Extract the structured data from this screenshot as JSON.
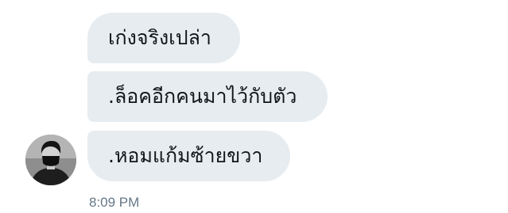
{
  "conversation": {
    "messages": [
      {
        "text": "เก่งจริงเปล่า"
      },
      {
        "text": ".ล็อคอีกคนมาไว้กับตัว"
      },
      {
        "text": ".หอมแก้มซ้ายขวา"
      }
    ],
    "timestamp": "8:09 PM",
    "sender_avatar_icon": "user-avatar"
  },
  "colors": {
    "bubble_background": "#e6ecf0",
    "bubble_text": "#14171a",
    "timestamp_text": "#657786"
  }
}
